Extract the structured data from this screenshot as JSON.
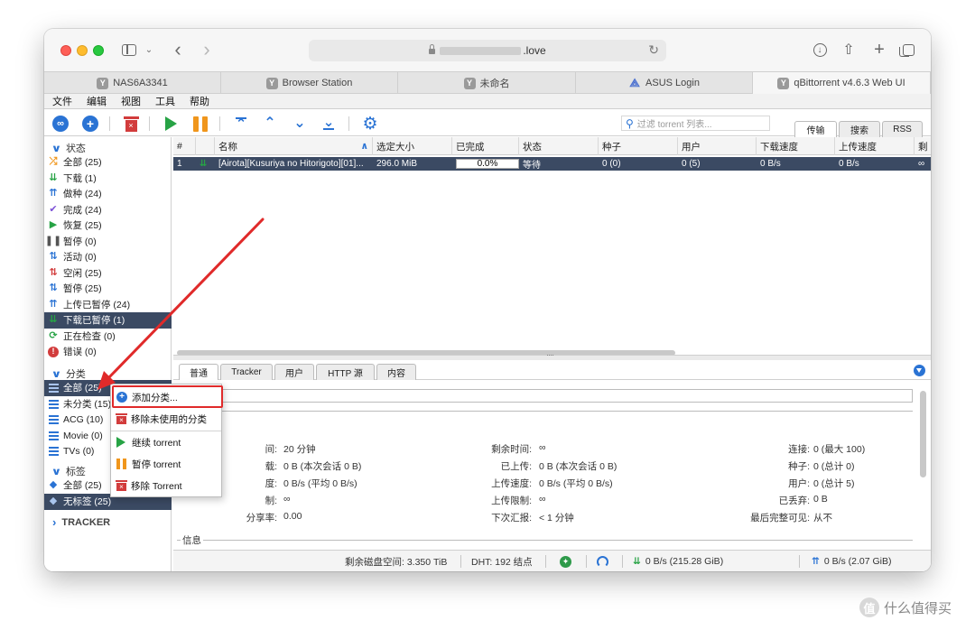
{
  "browser": {
    "url_visible": ".love",
    "tabs": [
      {
        "favicon": "Y",
        "label": "NAS6A3341"
      },
      {
        "favicon": "Y",
        "label": "Browser Station"
      },
      {
        "favicon": "Y",
        "label": "未命名"
      },
      {
        "favicon": "asus-icon",
        "label": "ASUS Login"
      },
      {
        "favicon": "Y",
        "label": "qBittorrent v4.6.3 Web UI"
      }
    ]
  },
  "menu": [
    "文件",
    "编辑",
    "视图",
    "工具",
    "帮助"
  ],
  "search": {
    "placeholder": "过滤 torrent 列表..."
  },
  "view_tabs": [
    "传输",
    "搜索",
    "RSS"
  ],
  "filters": {
    "status_title": "状态",
    "status": [
      {
        "label": "全部 (25)",
        "icon": "shuffle-icon",
        "color": "#f0961c"
      },
      {
        "label": "下载 (1)",
        "icon": "download-icon",
        "color": "#27a345"
      },
      {
        "label": "做种 (24)",
        "icon": "seed-icon",
        "color": "#2a73d4"
      },
      {
        "label": "完成 (24)",
        "icon": "check-icon",
        "color": "#7b4fd6"
      },
      {
        "label": "恢复 (25)",
        "icon": "play-icon",
        "color": "#27a345"
      },
      {
        "label": "暂停 (0)",
        "icon": "pause-icon",
        "color": "#555555"
      },
      {
        "label": "活动 (0)",
        "icon": "updown-icon",
        "color": "#2a73d4"
      },
      {
        "label": "空闲 (25)",
        "icon": "updown-red-icon",
        "color": "#d23c3c"
      },
      {
        "label": "暂停 (25)",
        "icon": "updown-blue-icon",
        "color": "#2a73d4"
      },
      {
        "label": "上传已暂停 (24)",
        "icon": "upload-paused-icon",
        "color": "#2a73d4"
      },
      {
        "label": "下载已暂停 (1)",
        "icon": "download-paused-icon",
        "color": "#27a345"
      },
      {
        "label": "正在检查 (0)",
        "icon": "refresh-icon",
        "color": "#27a345"
      },
      {
        "label": "错误 (0)",
        "icon": "error-icon",
        "color": "#d23c3c"
      }
    ],
    "category_title": "分类",
    "categories": [
      "全部 (25)",
      "未分类 (15)",
      "ACG (10)",
      "Movie (0)",
      "TVs (0)"
    ],
    "tag_title": "标签",
    "tags": [
      "全部 (25)",
      "无标签 (25)"
    ],
    "tracker_title": "TRACKER"
  },
  "table": {
    "headers": [
      "#",
      "",
      "名称",
      "选定大小",
      "已完成",
      "状态",
      "种子",
      "用户",
      "下载速度",
      "上传速度",
      "剩"
    ],
    "rows": [
      {
        "num": "1",
        "name": "[Airota][Kusuriya no Hitorigoto][01]...",
        "size": "296.0 MiB",
        "progress": "0.0%",
        "progress_fraction": 0.0,
        "status": "等待",
        "seeds": "0 (0)",
        "peers": "0 (5)",
        "dl_speed": "0 B/s",
        "up_speed": "0 B/s",
        "eta": "∞"
      }
    ]
  },
  "detail_tabs": [
    "普通",
    "Tracker",
    "用户",
    "HTTP 源",
    "内容"
  ],
  "transfer": {
    "col1": [
      {
        "label": "间:",
        "value": "20 分钟"
      },
      {
        "label": "载:",
        "value": "0 B (本次会话 0 B)"
      },
      {
        "label": "度:",
        "value": "0 B/s (平均 0 B/s)"
      },
      {
        "label": "制:",
        "value": "∞"
      },
      {
        "label": "分享率:",
        "value": "0.00"
      }
    ],
    "col2": [
      {
        "label": "剩余时间:",
        "value": "∞"
      },
      {
        "label": "已上传:",
        "value": "0 B (本次会话 0 B)"
      },
      {
        "label": "上传速度:",
        "value": "0 B/s (平均 0 B/s)"
      },
      {
        "label": "上传限制:",
        "value": "∞"
      },
      {
        "label": "下次汇报:",
        "value": "< 1 分钟"
      }
    ],
    "col3": [
      {
        "label": "连接:",
        "value": "0 (最大 100)"
      },
      {
        "label": "种子:",
        "value": "0 (总计 0)"
      },
      {
        "label": "用户:",
        "value": "0 (总计 5)"
      },
      {
        "label": "已丢弃:",
        "value": "0 B"
      },
      {
        "label": "最后完整可见:",
        "value": "从不"
      }
    ],
    "info_legend": "信息"
  },
  "statusbar": {
    "disk": "剩余磁盘空间: 3.350 TiB",
    "dht": "DHT: 192 结点",
    "dl": "0 B/s (215.28 GiB)",
    "up": "0 B/s (2.07 GiB)"
  },
  "context_menu": [
    {
      "label": "添加分类...",
      "icon": "add-icon"
    },
    {
      "label": "移除未使用的分类",
      "icon": "trash-icon"
    },
    {
      "label": "继续 torrent",
      "icon": "play-icon"
    },
    {
      "label": "暂停 torrent",
      "icon": "pause-icon"
    },
    {
      "label": "移除 Torrent",
      "icon": "trash-icon"
    }
  ],
  "watermark": "什么值得买",
  "colors": {
    "selection": "#3b4a63",
    "accent": "#2a73d4",
    "annotation": "#e02a2a"
  }
}
